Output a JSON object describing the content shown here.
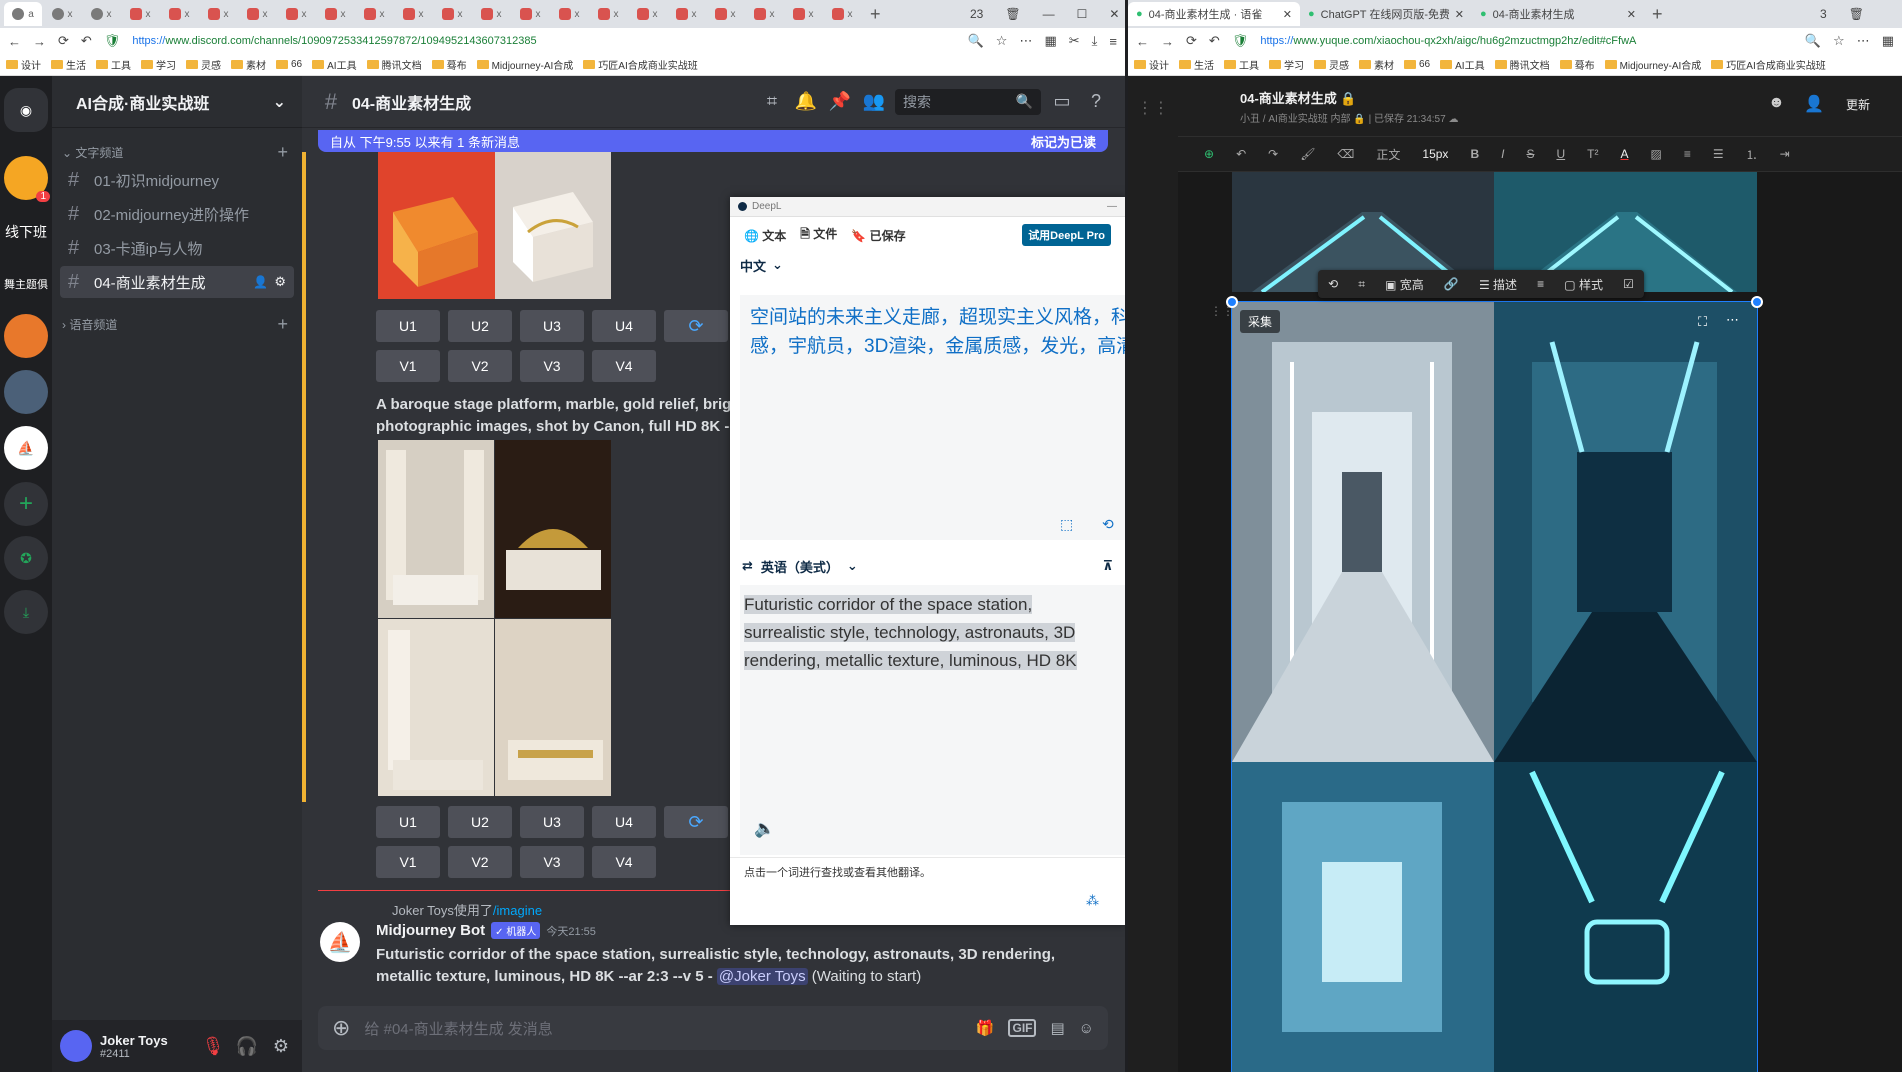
{
  "left_browser": {
    "tabs": [
      {
        "label": "a",
        "active": true
      },
      {
        "label": "x"
      },
      {
        "label": "x"
      },
      {
        "label": "x"
      },
      {
        "label": "x"
      },
      {
        "label": "x"
      },
      {
        "label": "x"
      },
      {
        "label": "x"
      },
      {
        "label": "x"
      },
      {
        "label": "x"
      },
      {
        "label": "x"
      },
      {
        "label": "x"
      },
      {
        "label": "x"
      },
      {
        "label": "x"
      },
      {
        "label": "x"
      },
      {
        "label": "x"
      },
      {
        "label": "x"
      },
      {
        "label": "x"
      },
      {
        "label": "x"
      },
      {
        "label": "x"
      },
      {
        "label": "x"
      },
      {
        "label": "x"
      }
    ],
    "new_tab": "+",
    "window_badge": "23",
    "url_prefix": "https://",
    "url": "www.discord.com/channels/1090972533412597872/1094952143607312385",
    "bookmarks": [
      "设计",
      "生活",
      "工具",
      "学习",
      "灵感",
      "素材",
      "66",
      "AI工具",
      "腾讯文档",
      "蓦布",
      "Midjourney-AI合成",
      "巧匠AI合成商业实战班"
    ]
  },
  "discord": {
    "guild_name": "AI合成·商业实战班",
    "server_labels": [
      "线下班",
      "舞主题俱"
    ],
    "category_text": "文字频道",
    "category_voice": "语音频道",
    "channels": [
      "01-初识midjourney",
      "02-midjourney进阶操作",
      "03-卡通ip与人物",
      "04-商业素材生成"
    ],
    "channel_title": "04-商业素材生成",
    "search_placeholder": "搜索",
    "banner_text": "自从 下午9:55 以来有 1 条新消息",
    "banner_action": "标记为已读",
    "upscale": [
      "U1",
      "U2",
      "U3",
      "U4"
    ],
    "variation": [
      "V1",
      "V2",
      "V3",
      "V4"
    ],
    "refresh": "⟳",
    "msg_baroque_1": "A baroque stage platform, marble, gold relief, brig",
    "msg_baroque_2": "photographic images, shot by Canon, full HD 8K --",
    "reply_user": "Joker Toys使用了",
    "reply_cmd": "/imagine",
    "bot_name": "Midjourney Bot",
    "bot_tag": "✓ 机器人",
    "bot_time": "今天21:55",
    "bot_msg_1": "Futuristic corridor of the space station, surrealistic style, technology, astronauts, 3D rendering,",
    "bot_msg_2": "metallic texture, luminous, HD 8K --ar 2:3 --v 5 -",
    "bot_mention": "@Joker Toys",
    "bot_status": "(Waiting to start)",
    "composer_placeholder": "给 #04-商业素材生成 发消息",
    "user_name": "Joker Toys",
    "user_tag": "#2411",
    "unread_badge": "1",
    "gif": "GIF"
  },
  "deepl": {
    "title": "DeepL",
    "tabs": [
      "文本",
      "文件",
      "已保存"
    ],
    "pro": "试用DeepL Pro",
    "source_lang": "中文",
    "source_line_1": "空间站的未来主义走廊，超现实主义风格，科",
    "source_line_2": "感，宇航员，3D渲染，金属质感，发光，高清",
    "target_lang": "英语（美式）",
    "target_line_1": "Futuristic corridor of the space station,",
    "target_line_2": "surrealistic style, technology, astronauts, 3D",
    "target_line_3": "rendering, metallic texture, luminous, HD 8K",
    "hint": "点击一个词进行查找或查看其他翻译。"
  },
  "right_browser": {
    "tabs": [
      "04-商业素材生成 · 语雀",
      "ChatGPT 在线网页版-免费使",
      "04-商业素材生成"
    ],
    "new_tab": "+",
    "window_badge": "3",
    "url_prefix": "https://",
    "url": "www.yuque.com/xiaochou-qx2xh/aigc/hu6g2mzuctmgp2hz/edit#cFfwA",
    "bookmarks": [
      "设计",
      "生活",
      "工具",
      "学习",
      "灵感",
      "素材",
      "66",
      "AI工具",
      "腾讯文档",
      "蓦布",
      "Midjourney-AI合成",
      "巧匠AI合成商业实战班"
    ]
  },
  "yuque": {
    "doc_title": "04-商业素材生成",
    "breadcrumb": "小丑 / AI商业实战班 内部",
    "saved": "已保存 21:34:57",
    "update_btn": "更新",
    "style": "正文",
    "font_size": "15px",
    "img_tools": [
      "宽高",
      "描述",
      "样式"
    ],
    "caiji": "采集"
  }
}
